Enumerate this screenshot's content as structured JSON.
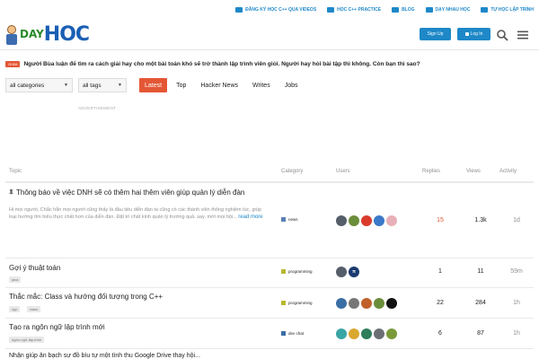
{
  "promo_bar": {
    "links": [
      {
        "label": "ĐĂNG KÝ HỌC C++ QUA VIDEOS",
        "icon": "video-icon"
      },
      {
        "label": "HỌC C++ PRACTICE",
        "icon": "code-icon"
      },
      {
        "label": "BLOG",
        "icon": "blog-icon"
      },
      {
        "label": "DẠY NHAU HỌC",
        "icon": "facebook-icon"
      },
      {
        "label": "TỰ HỌC LẬP TRÌNH",
        "icon": "facebook-icon"
      }
    ]
  },
  "header": {
    "logo_day": "DAY",
    "logo_hoc": "HOC",
    "signup_label": "Sign Up",
    "login_label": "Log In",
    "icons": {
      "search": "search-icon",
      "menu": "hamburger-icon"
    }
  },
  "banner": {
    "badge": "Ghim",
    "text": "Người Bùa luận để tìm ra cách giải hay cho một bài toán khó sẽ trở thành lập trình viên giỏi. Người hay hỏi bài tập thì không. Còn bạn thì sao?"
  },
  "filters": {
    "categories": "all categories",
    "tags": "all tags",
    "tabs": [
      "Latest",
      "Top",
      "Hacker News",
      "Writes",
      "Jobs"
    ],
    "active_tab": "Latest"
  },
  "ad_label": "ADVERTISEMENT",
  "columns": {
    "topic": "Topic",
    "category": "Category",
    "users": "Users",
    "replies": "Replies",
    "views": "Views",
    "activity": "Activity"
  },
  "topics": [
    {
      "title": "Thông báo về việc DNH sẽ có thêm hai thêm viên giúp quản lý diễn đàn",
      "pinned": true,
      "excerpt": "Hi mọi người, Chắc hẳn mọi người cũng thấy là đầu tiêu diễn đàn ta cũng có các thành viên thông nghiêm túc, giúp loại hướng tìm hiểu thực chất hơn của diễn đàn. Đặt trì chất kinh quản lý trường quả. say. mời mọi hội...",
      "read_more": "read more",
      "category": "news",
      "category_color": "#5b7fb5",
      "avatars": [
        "#555f6a",
        "#6b8e3a",
        "#d93a2b",
        "#3a78c8",
        "#e8b0b8"
      ],
      "replies": "15",
      "replies_hot": true,
      "views": "1.3k",
      "activity": "1d"
    },
    {
      "title": "Gợi ý thuật toán",
      "tag": "java",
      "category": "programming",
      "category_color": "#b8b82e",
      "avatars": [
        "#555f6a",
        "#1a3a6e"
      ],
      "avatar_letters": [
        "",
        "π"
      ],
      "replies": "1",
      "replies_hot": false,
      "views": "11",
      "activity": "59m"
    },
    {
      "title": "Thắc mắc: Class và hướng đối tượng trong C++",
      "tags": [
        "cpp",
        "class"
      ],
      "category": "programming",
      "category_color": "#b8b82e",
      "avatars": [
        "#3a6ea5",
        "#777777",
        "#c0612b",
        "#6b8e3a",
        "#111111"
      ],
      "replies": "22",
      "replies_hot": false,
      "views": "284",
      "activity": "1h"
    },
    {
      "title": "Tạo ra ngôn ngữ lập trình mới",
      "tag": "ngôn-ngữ-lập-trình",
      "category": "dev chat",
      "category_color": "#3a6ea5",
      "avatars": [
        "#3aa5a5",
        "#d9a830",
        "#2e7d5b",
        "#6b6f75",
        "#7a9a3a"
      ],
      "replies": "6",
      "replies_hot": false,
      "views": "87",
      "activity": "1h"
    }
  ],
  "cut_off_title": "Nhận giúp ăn bạch sự đồ bìu tự một tình thu Google Drive thay hội..."
}
